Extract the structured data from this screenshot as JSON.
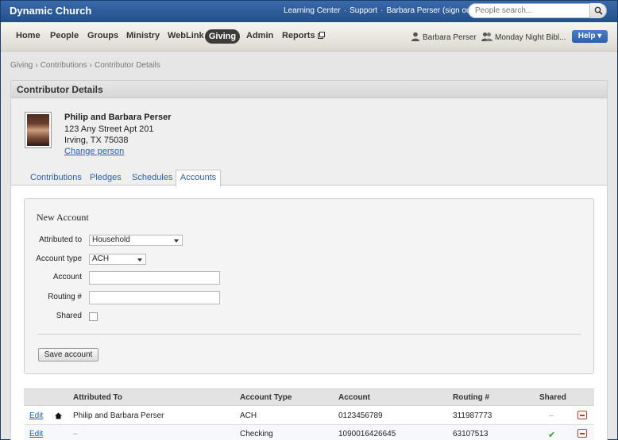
{
  "header": {
    "app_title": "Dynamic Church",
    "links": [
      "Learning Center",
      "Support",
      "Barbara Perser (sign out)"
    ],
    "search_placeholder": "People search..."
  },
  "nav": {
    "items": [
      "Home",
      "People",
      "Groups",
      "Ministry",
      "WebLink",
      "Giving",
      "Admin",
      "Reports"
    ],
    "active": "Giving",
    "user": "Barbara Perser",
    "group": "Monday Night Bibl...",
    "help": "Help ▾"
  },
  "breadcrumb": [
    "Giving",
    "Contributions",
    "Contributor Details"
  ],
  "panel": {
    "title": "Contributor Details",
    "person": {
      "name": "Philip and Barbara Perser",
      "address1": "123 Any Street Apt 201",
      "address2": "Irving, TX 75038",
      "change_link": "Change person"
    },
    "tabs": [
      "Contributions",
      "Pledges",
      "Schedules",
      "Accounts"
    ],
    "active_tab": "Accounts"
  },
  "new_account": {
    "title": "New Account",
    "fields": {
      "attributed_to": {
        "label": "Attributed to",
        "value": "Household"
      },
      "account_type": {
        "label": "Account type",
        "value": "ACH"
      },
      "account": {
        "label": "Account",
        "value": ""
      },
      "routing": {
        "label": "Routing #",
        "value": ""
      },
      "shared": {
        "label": "Shared",
        "checked": false
      }
    },
    "save_label": "Save account"
  },
  "table": {
    "columns": [
      "Attributed To",
      "Account Type",
      "Account",
      "Routing #",
      "Shared"
    ],
    "rows": [
      {
        "edit": "Edit",
        "attributed_to": "Philip and Barbara Perser",
        "icon": "home-icon",
        "account_type": "ACH",
        "account": "0123456789",
        "routing": "311987773",
        "shared": "–"
      },
      {
        "edit": "Edit",
        "attributed_to": "–",
        "icon": "",
        "account_type": "Checking",
        "account": "1090016426645",
        "routing": "63107513",
        "shared": "✔"
      }
    ]
  },
  "colors": {
    "topbar": "#2d5c9b",
    "link": "#2a5fa8",
    "active_nav": "#3b3b3b",
    "help": "#3a6cb6",
    "delete": "#d12e2e",
    "check": "#2f9e2f"
  }
}
